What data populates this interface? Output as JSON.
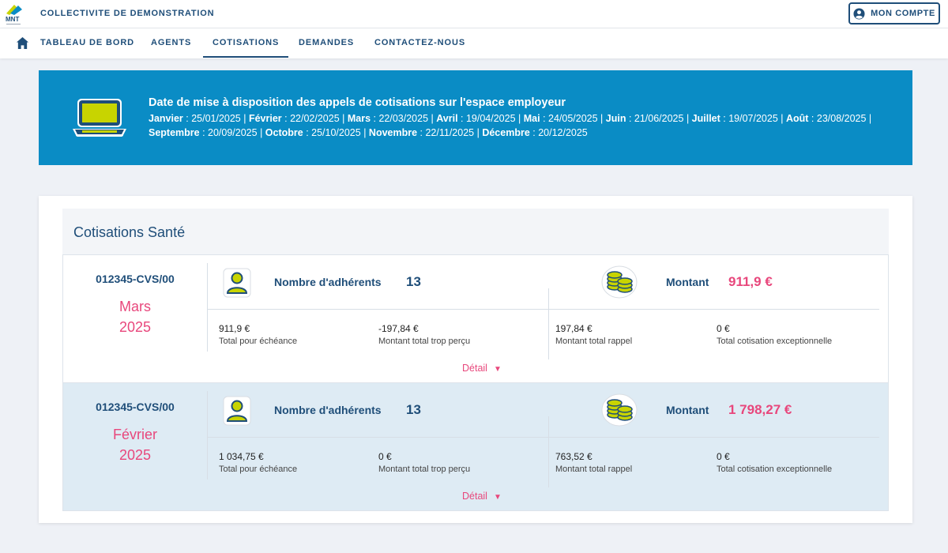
{
  "header": {
    "logo_text": "MNT",
    "org_name": "COLLECTIVITE DE DEMONSTRATION",
    "account_label": "MON COMPTE"
  },
  "nav": {
    "items": [
      "TABLEAU DE BORD",
      "AGENTS",
      "COTISATIONS",
      "DEMANDES",
      "CONTACTEZ-NOUS"
    ],
    "active": "COTISATIONS"
  },
  "banner": {
    "title": "Date de mise à disposition des appels de cotisations sur l'espace employeur",
    "dates": [
      {
        "month": "Janvier",
        "date": "25/01/2025"
      },
      {
        "month": "Février",
        "date": "22/02/2025"
      },
      {
        "month": "Mars",
        "date": "22/03/2025"
      },
      {
        "month": "Avril",
        "date": "19/04/2025"
      },
      {
        "month": "Mai",
        "date": "24/05/2025"
      },
      {
        "month": "Juin",
        "date": "21/06/2025"
      },
      {
        "month": "Juillet",
        "date": "19/07/2025"
      },
      {
        "month": "Août",
        "date": "23/08/2025"
      },
      {
        "month": "Septembre",
        "date": "20/09/2025"
      },
      {
        "month": "Octobre",
        "date": "25/10/2025"
      },
      {
        "month": "Novembre",
        "date": "22/11/2025"
      },
      {
        "month": "Décembre",
        "date": "20/12/2025"
      }
    ]
  },
  "section": {
    "title": "Cotisations Santé",
    "rows": [
      {
        "contract": "012345-CVS/00",
        "month": "Mars",
        "year": "2025",
        "adherents_label": "Nombre d'adhérents",
        "adherents": "13",
        "montant_label": "Montant",
        "montant": "911,9 €",
        "metrics": [
          {
            "value": "911,9 €",
            "label": "Total pour échéance"
          },
          {
            "value": "-197,84 €",
            "label": "Montant total trop perçu"
          },
          {
            "value": "197,84 €",
            "label": "Montant total rappel"
          },
          {
            "value": "0 €",
            "label": "Total cotisation exceptionnelle"
          }
        ],
        "detail_label": "Détail"
      },
      {
        "contract": "012345-CVS/00",
        "month": "Février",
        "year": "2025",
        "adherents_label": "Nombre d'adhérents",
        "adherents": "13",
        "montant_label": "Montant",
        "montant": "1 798,27 €",
        "metrics": [
          {
            "value": "1 034,75 €",
            "label": "Total pour échéance"
          },
          {
            "value": "0 €",
            "label": "Montant total trop perçu"
          },
          {
            "value": "763,52 €",
            "label": "Montant total rappel"
          },
          {
            "value": "0 €",
            "label": "Total cotisation exceptionnelle"
          }
        ],
        "detail_label": "Détail"
      }
    ]
  },
  "colors": {
    "brand_blue": "#1f4e79",
    "banner_blue": "#0a8cc5",
    "accent_pink": "#e8477c",
    "icon_green": "#c8d400"
  },
  "icons": [
    "mnt-logo",
    "account-circle-icon",
    "home-icon",
    "laptop-icon",
    "person-icon",
    "coins-icon",
    "caret-down-icon"
  ]
}
